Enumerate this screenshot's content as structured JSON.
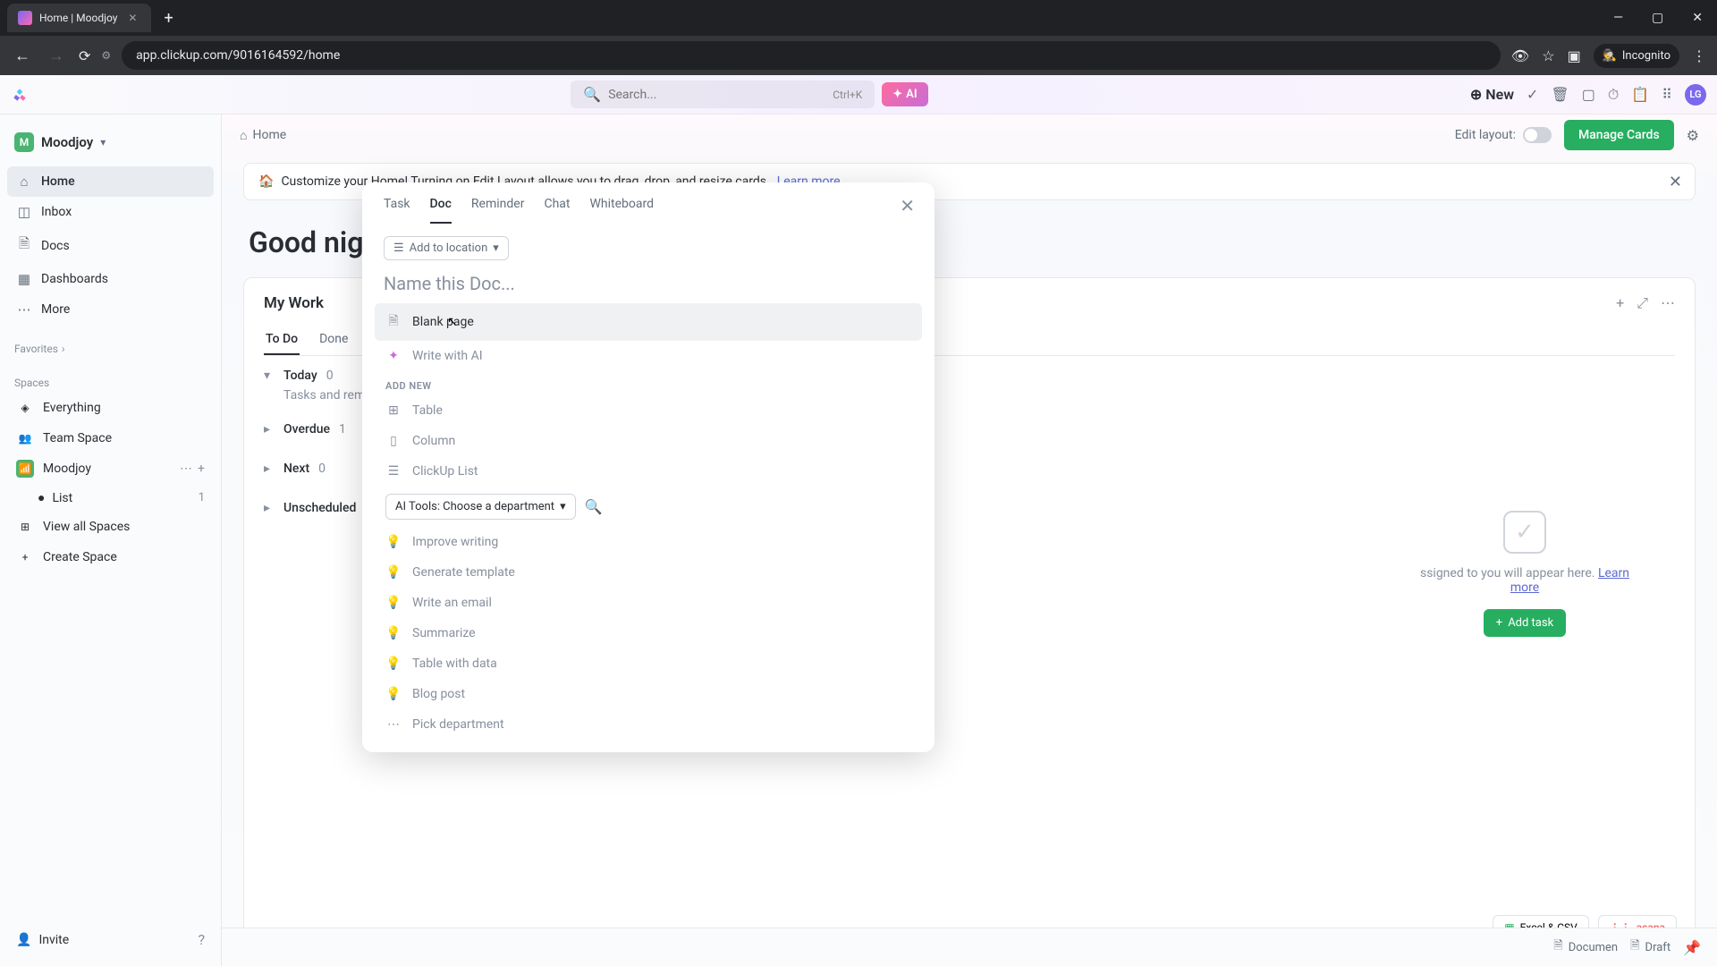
{
  "browser": {
    "tab_title": "Home | Moodjoy",
    "url": "app.clickup.com/9016164592/home",
    "incognito": "Incognito"
  },
  "topbar": {
    "search_placeholder": "Search...",
    "search_shortcut": "Ctrl+K",
    "ai_label": "AI",
    "new_label": "New",
    "avatar": "LG"
  },
  "sidebar": {
    "workspace_badge": "M",
    "workspace_name": "Moodjoy",
    "nav": {
      "home": "Home",
      "inbox": "Inbox",
      "docs": "Docs",
      "dashboards": "Dashboards",
      "more": "More"
    },
    "favorites_label": "Favorites",
    "spaces_label": "Spaces",
    "spaces": {
      "everything": "Everything",
      "team_space": "Team Space",
      "moodjoy": "Moodjoy",
      "list": "List",
      "list_count": "1",
      "view_all": "View all Spaces",
      "create": "Create Space"
    },
    "invite": "Invite"
  },
  "breadcrumb": {
    "home": "Home",
    "edit_layout": "Edit layout:",
    "manage_cards": "Manage Cards"
  },
  "banner": {
    "text": "Customize your Home! Turning on Edit Layout allows you to drag, drop, and resize cards.",
    "link": "Learn more"
  },
  "greeting": "Good nigh",
  "work": {
    "title": "My Work",
    "tab_todo": "To Do",
    "tab_done": "Done",
    "today": "Today",
    "today_count": "0",
    "today_helper": "Tasks and reminde",
    "overdue": "Overdue",
    "overdue_count": "1",
    "next": "Next",
    "next_count": "0",
    "unscheduled": "Unscheduled",
    "empty_text": "ssigned to you will appear here.",
    "empty_link": "Learn more",
    "add_task": "Add task"
  },
  "badges": {
    "excel": "Excel & CSV",
    "asana": "asana"
  },
  "dock": {
    "document": "Documen",
    "draft": "Draft"
  },
  "modal": {
    "tabs": {
      "task": "Task",
      "doc": "Doc",
      "reminder": "Reminder",
      "chat": "Chat",
      "whiteboard": "Whiteboard"
    },
    "location": "Add to location",
    "name_placeholder": "Name this Doc...",
    "options": {
      "blank": "Blank page",
      "write_ai": "Write with AI"
    },
    "add_new_label": "ADD NEW",
    "add_new": {
      "table": "Table",
      "column": "Column",
      "clickup_list": "ClickUp List"
    },
    "ai_tools": "AI Tools: Choose a department",
    "ai_items": {
      "improve": "Improve writing",
      "generate": "Generate template",
      "email": "Write an email",
      "summarize": "Summarize",
      "table_data": "Table with data",
      "blog": "Blog post",
      "pick": "Pick department"
    }
  }
}
